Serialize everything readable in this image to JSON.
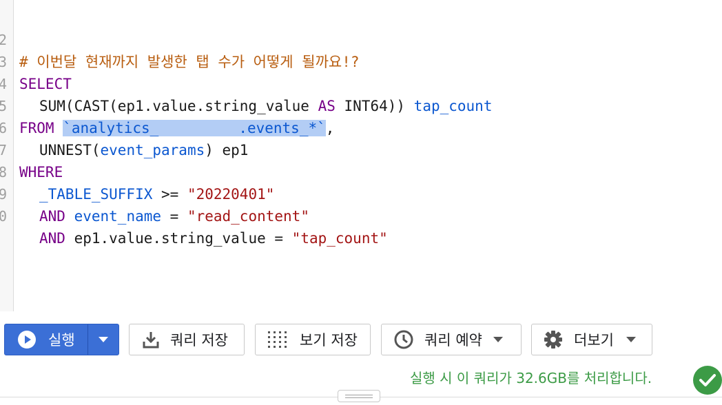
{
  "editor": {
    "lines": [
      {
        "no": "2",
        "comment": "# 이번달 현재까지 발생한 탭 수가 어떻게 될까요!?"
      },
      {
        "no": "3",
        "kw": "SELECT"
      },
      {
        "no": "4",
        "fn": "SUM(CAST(ep1.value.string_value ",
        "kw": "AS",
        "fn2": " INT64)) ",
        "alias": "tap_count"
      },
      {
        "no": "5",
        "kw": "FROM",
        "sel_a": "`analytics_",
        "sel_b": ".events_*`",
        "tail": ","
      },
      {
        "no": "6",
        "fn": "UNNEST(",
        "id": "event_params",
        "fn2": ") ep1"
      },
      {
        "no": "7",
        "kw": "WHERE"
      },
      {
        "no": "8",
        "id": "_TABLE_SUFFIX",
        "op": " >= ",
        "str": "\"20220401\""
      },
      {
        "no": "9",
        "kw": "AND",
        "id": " event_name",
        "op": " = ",
        "str": "\"read_content\""
      },
      {
        "no": "0",
        "kw": "AND",
        "pl": " ep1.value.string_value = ",
        "str": "\"tap_count\""
      }
    ]
  },
  "toolbar": {
    "run_label": "실행",
    "save_query_label": "쿼리 저장",
    "save_view_label": "보기 저장",
    "schedule_label": "쿼리 예약",
    "more_label": "더보기"
  },
  "status": {
    "message": "실행 시 이 쿼리가 32.6GB를 처리합니다."
  },
  "colors": {
    "accent": "#3b6fd6",
    "success": "#3c9b46",
    "keyword": "#770088",
    "identifier": "#0b57d0",
    "string": "#a31515",
    "comment": "#b85d0f"
  }
}
